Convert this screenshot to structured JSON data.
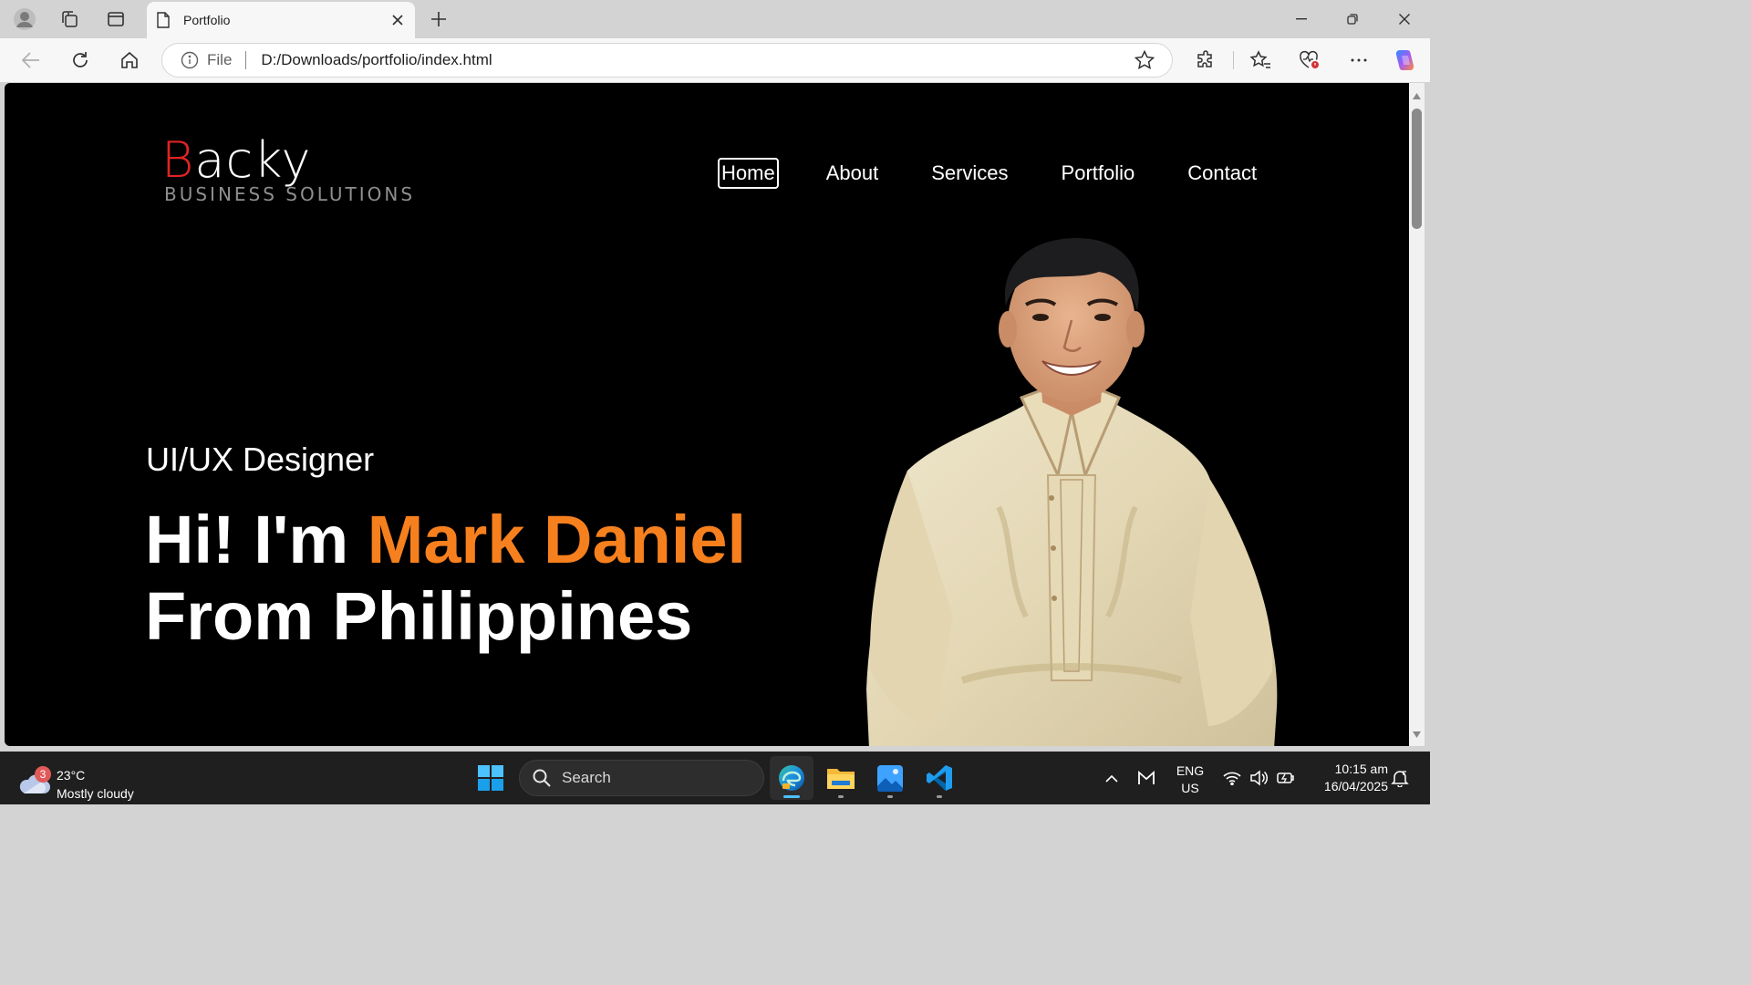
{
  "browser": {
    "tab": {
      "title": "Portfolio",
      "favicon": "page-icon"
    },
    "omnibox": {
      "scheme": "File",
      "url": "D:/Downloads/portfolio/index.html"
    },
    "toolbar_icons": [
      "back-icon",
      "refresh-icon",
      "home-icon",
      "favorite-star-icon",
      "extensions-icon",
      "favorites-icon",
      "browser-essentials-icon",
      "more-icon",
      "copilot-icon"
    ]
  },
  "page": {
    "logo": {
      "first_letter": "B",
      "rest": "acky",
      "tagline": "BUSINESS SOLUTIONS"
    },
    "nav": {
      "home": "Home",
      "about": "About",
      "services": "Services",
      "portfolio": "Portfolio",
      "contact": "Contact"
    },
    "hero": {
      "role": "UI/UX Designer",
      "greeting": "Hi! I'm",
      "name": "Mark Daniel",
      "origin": "From Philippines"
    },
    "colors": {
      "accent_orange": "#f7801e",
      "logo_red": "#e02424",
      "background": "#000000"
    }
  },
  "taskbar": {
    "weather": {
      "badge": "3",
      "temp": "23°C",
      "condition": "Mostly cloudy"
    },
    "search_placeholder": "Search",
    "apps": [
      "edge-icon",
      "file-explorer-icon",
      "photos-icon",
      "vscode-icon"
    ],
    "lang": {
      "line1": "ENG",
      "line2": "US"
    },
    "time": "10:15 am",
    "date": "16/04/2025"
  }
}
